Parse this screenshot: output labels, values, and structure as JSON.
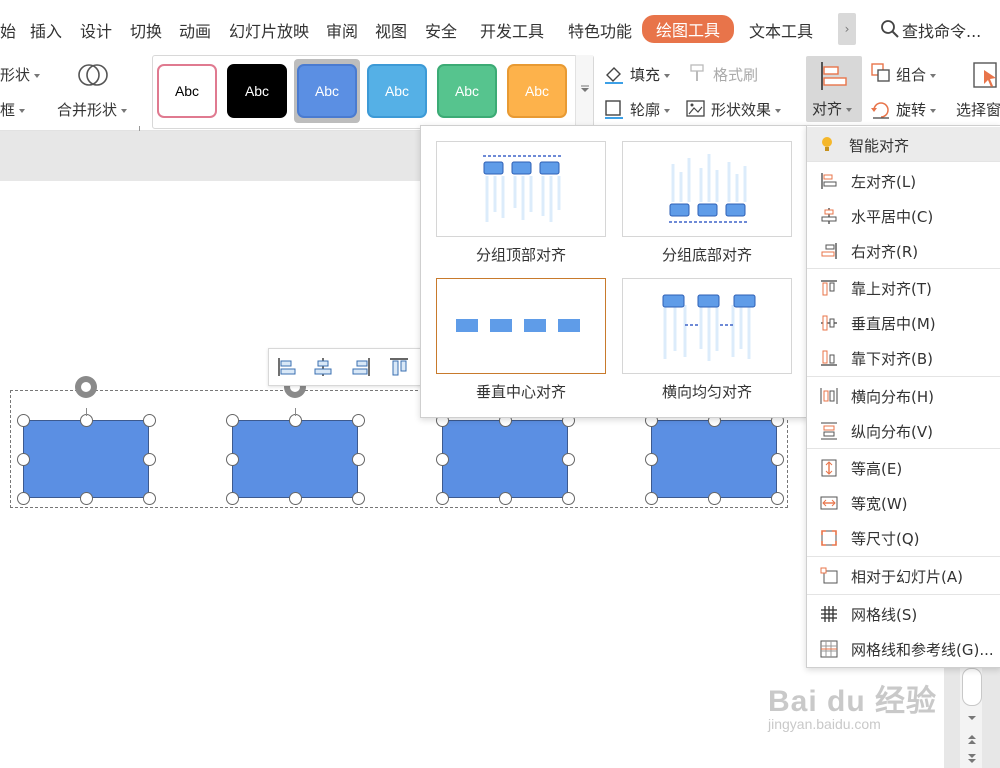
{
  "tabs": [
    {
      "label": "始",
      "active": false
    },
    {
      "label": "插入",
      "active": false
    },
    {
      "label": "设计",
      "active": false
    },
    {
      "label": "切换",
      "active": false
    },
    {
      "label": "动画",
      "active": false
    },
    {
      "label": "幻灯片放映",
      "active": false
    },
    {
      "label": "审阅",
      "active": false
    },
    {
      "label": "视图",
      "active": false
    },
    {
      "label": "安全",
      "active": false
    },
    {
      "label": "开发工具",
      "active": false
    },
    {
      "label": "特色功能",
      "active": false
    },
    {
      "label": "绘图工具",
      "active": true
    },
    {
      "label": "文本工具",
      "active": false
    }
  ],
  "more_glyph": "›",
  "search": {
    "label": "查找命令..."
  },
  "ribbon": {
    "shape_label": "形状",
    "frame_label": "框",
    "merge_label": "合并形状",
    "styles": [
      {
        "text": "Abc",
        "bg": "#ffffff",
        "fg": "#000000",
        "border": "#e07a90"
      },
      {
        "text": "Abc",
        "bg": "#000000",
        "fg": "#ffffff",
        "border": "#000000"
      },
      {
        "text": "Abc",
        "bg": "#5b8fe3",
        "fg": "#ffffff",
        "border": "#4a7bd0"
      },
      {
        "text": "Abc",
        "bg": "#55b0e6",
        "fg": "#ffffff",
        "border": "#3d9ad6"
      },
      {
        "text": "Abc",
        "bg": "#56c48e",
        "fg": "#ffffff",
        "border": "#3cab75"
      },
      {
        "text": "Abc",
        "bg": "#fdb24b",
        "fg": "#ffffff",
        "border": "#e89a33"
      }
    ],
    "fill_label": "填充",
    "format_brush_label": "格式刷",
    "outline_label": "轮廓",
    "shape_effect_label": "形状效果",
    "align_label": "对齐",
    "group_label": "组合",
    "rotate_label": "旋转",
    "select_pane_label": "选择窗"
  },
  "smart_align": {
    "options": [
      {
        "label": "分组顶部对齐",
        "selected": false
      },
      {
        "label": "分组底部对齐",
        "selected": false
      },
      {
        "label": "垂直中心对齐",
        "selected": true
      },
      {
        "label": "横向均匀对齐",
        "selected": false
      }
    ]
  },
  "align_menu": {
    "smart": "智能对齐",
    "items": [
      {
        "label": "左对齐(L)",
        "icon": "align-left-icon"
      },
      {
        "label": "水平居中(C)",
        "icon": "align-center-icon"
      },
      {
        "label": "右对齐(R)",
        "icon": "align-right-icon"
      },
      {
        "label": "靠上对齐(T)",
        "icon": "align-top-icon"
      },
      {
        "label": "垂直居中(M)",
        "icon": "align-middle-icon"
      },
      {
        "label": "靠下对齐(B)",
        "icon": "align-bottom-icon"
      },
      {
        "label": "横向分布(H)",
        "icon": "distribute-horizontal-icon"
      },
      {
        "label": "纵向分布(V)",
        "icon": "distribute-vertical-icon"
      },
      {
        "label": "等高(E)",
        "icon": "same-height-icon"
      },
      {
        "label": "等宽(W)",
        "icon": "same-width-icon"
      },
      {
        "label": "等尺寸(Q)",
        "icon": "same-size-icon"
      },
      {
        "label": "相对于幻灯片(A)",
        "icon": "relative-to-slide-icon"
      },
      {
        "label": "网格线(S)",
        "icon": "gridlines-icon"
      },
      {
        "label": "网格线和参考线(G)...",
        "icon": "gridlines-guides-icon"
      }
    ]
  },
  "shape_count": 4,
  "colors": {
    "accent": "#e8744a",
    "shape_fill": "#5b8fe3",
    "shape_border": "#3d5a8f"
  },
  "watermark": {
    "main": "Bai du 经验",
    "sub": "jingyan.baidu.com"
  }
}
